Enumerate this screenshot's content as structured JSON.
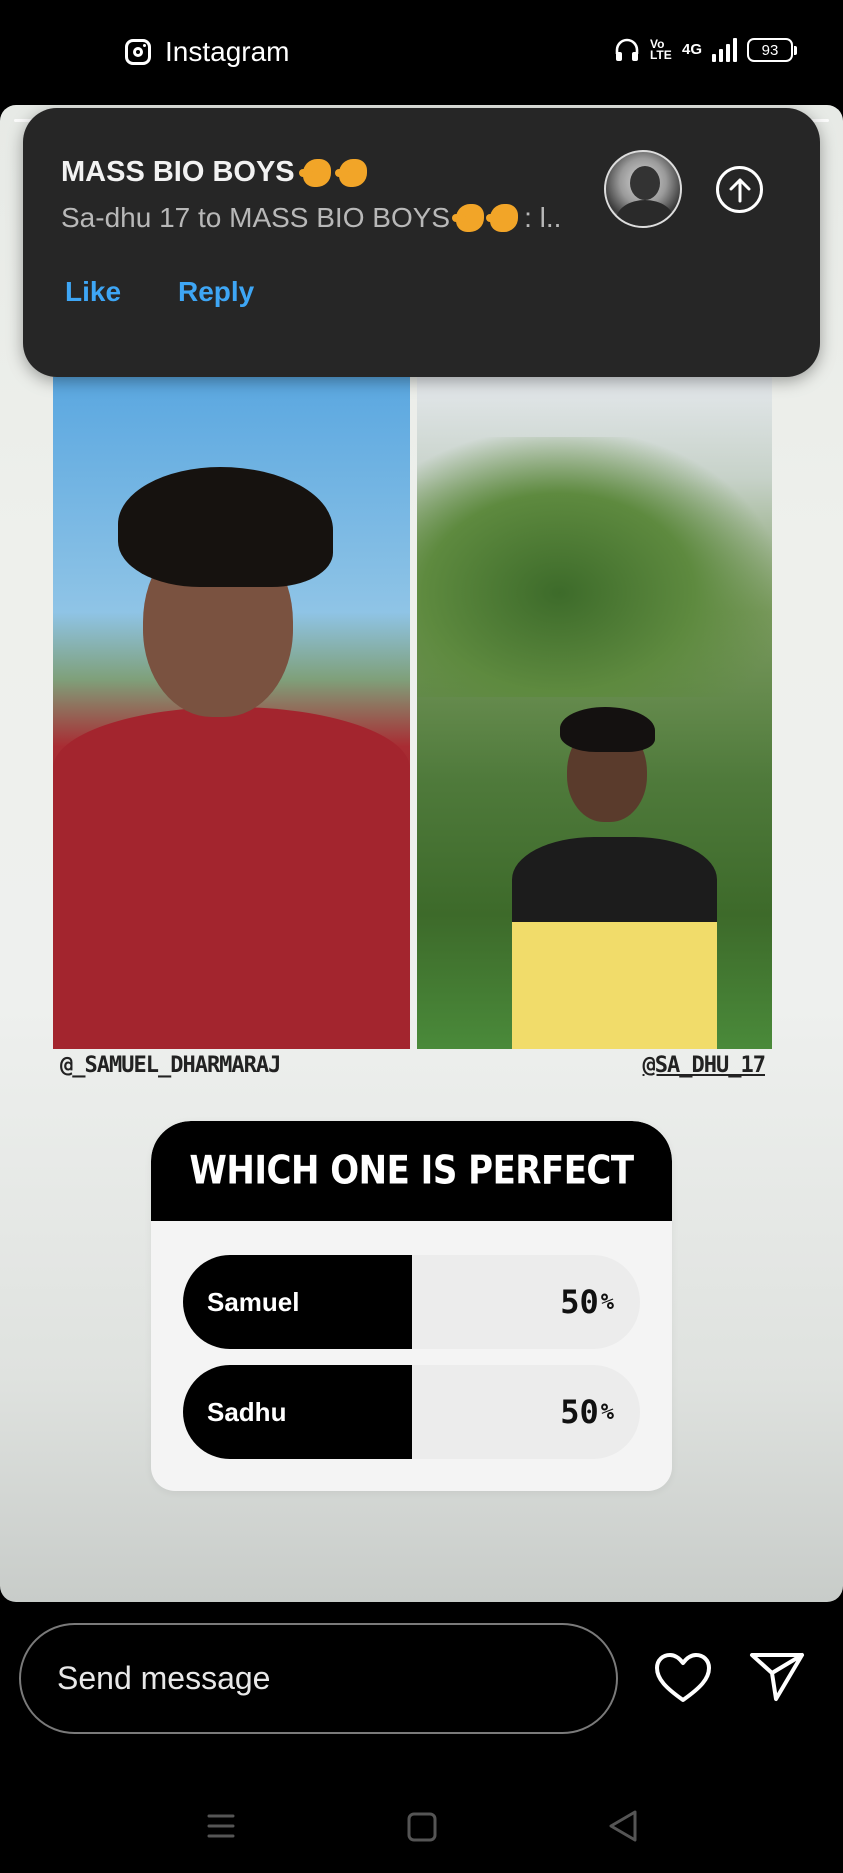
{
  "status_bar": {
    "app_name": "Instagram",
    "network_volte": "Vo LTE",
    "network_type": "4G",
    "battery": "93"
  },
  "story": {
    "handle_left": "@_SAMUEL_DHARMARAJ",
    "handle_right": "@SA_DHU_17",
    "poll": {
      "question": "WHICH ONE IS PERFECT",
      "options": [
        {
          "label": "Samuel",
          "percent": "50",
          "fraction": 0.5
        },
        {
          "label": "Sadhu",
          "percent": "50",
          "fraction": 0.5
        }
      ],
      "percent_sign": "%"
    }
  },
  "notification": {
    "title": "MASS BIO BOYS",
    "body": "Sa-dhu 17 to MASS BIO BOYS",
    "body_suffix": ": l..",
    "like_label": "Like",
    "reply_label": "Reply"
  },
  "composer": {
    "placeholder": "Send message"
  },
  "colors": {
    "accent_link": "#3ea6f5",
    "notification_bg": "#262626",
    "poll_header": "#000000"
  },
  "icons": {
    "app": "instagram-icon",
    "headset": "headset-icon",
    "signal": "signal-icon",
    "battery": "battery-icon",
    "avatar": "avatar",
    "upload": "arrow-up-circle-icon",
    "heart": "heart-icon",
    "send": "send-icon",
    "nav_menu": "menu-icon",
    "nav_home": "home-square-icon",
    "nav_back": "back-triangle-icon"
  }
}
